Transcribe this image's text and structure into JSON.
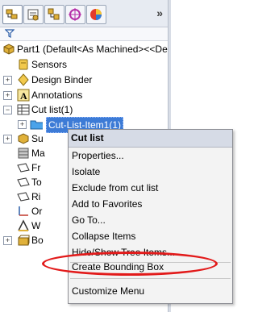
{
  "tabs": [
    {
      "name": "FeatureManager design tree",
      "icon": "feature-tree-icon"
    },
    {
      "name": "PropertyManager",
      "icon": "property-manager-icon"
    },
    {
      "name": "ConfigurationManager",
      "icon": "configuration-manager-icon"
    },
    {
      "name": "DimXpertManager",
      "icon": "dimxpert-icon"
    },
    {
      "name": "DisplayManager",
      "icon": "display-manager-icon"
    }
  ],
  "tab_overflow_label": "»",
  "tree": {
    "root": "Part1  (Default<As Machined><<De",
    "items": [
      {
        "label": "Sensors",
        "icon": "sensor-icon"
      },
      {
        "label": "Design Binder",
        "icon": "design-binder-icon"
      },
      {
        "label": "Annotations",
        "icon": "annotations-icon"
      },
      {
        "label": "Cut list(1)",
        "icon": "cut-list-icon"
      },
      {
        "label": "Cut-List-Item1(1)",
        "icon": "folder-icon",
        "selected": true
      },
      {
        "label": "Su",
        "icon": "solid-bodies-icon"
      },
      {
        "label": "Ma",
        "icon": "material-icon"
      },
      {
        "label": "Fr",
        "icon": "front-plane-icon"
      },
      {
        "label": "To",
        "icon": "top-plane-icon"
      },
      {
        "label": "Ri",
        "icon": "right-plane-icon"
      },
      {
        "label": "Or",
        "icon": "origin-icon"
      },
      {
        "label": "W",
        "icon": "weldment-icon"
      },
      {
        "label": "Bo",
        "icon": "boss-extrude-icon"
      }
    ]
  },
  "context_menu": {
    "title": "Cut list",
    "items": [
      "Properties...",
      "Isolate",
      "Exclude from cut list",
      "Add to Favorites",
      "Go To...",
      "Collapse Items",
      "Hide/Show Tree Items...",
      "Create Bounding Box",
      "Customize Menu"
    ],
    "highlighted_item": "Create Bounding Box"
  },
  "colors": {
    "selection": "#3d7bd6",
    "highlight_ring": "#e21a1a"
  }
}
